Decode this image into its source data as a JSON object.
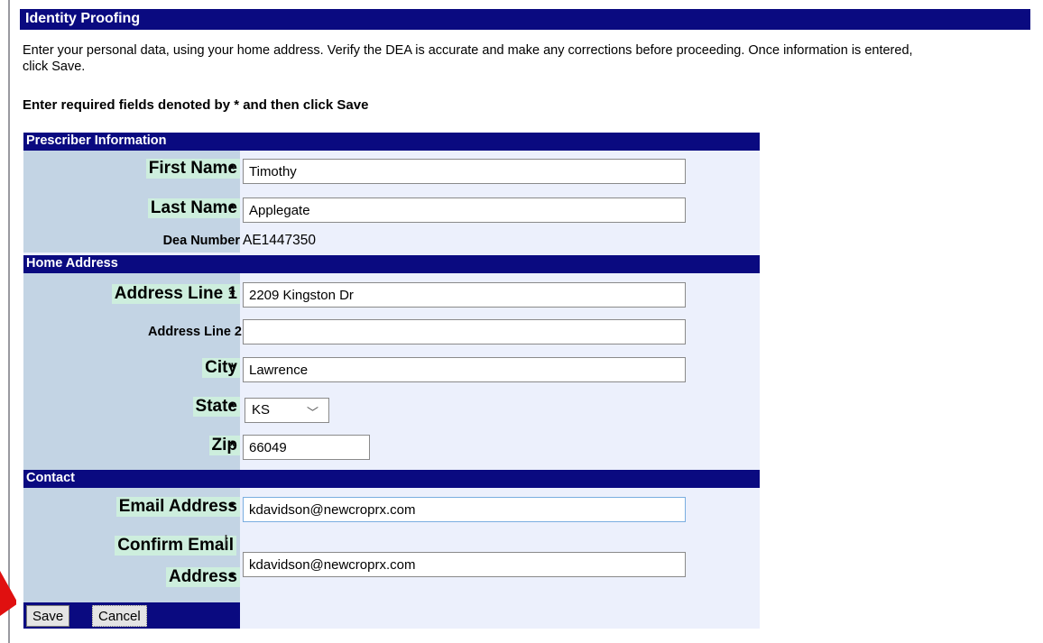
{
  "page": {
    "title": "Identity Proofing",
    "instructions": "Enter your personal data, using your home address. Verify the DEA is accurate and make any corrections before proceeding. Once information is entered, click Save.",
    "required_note": "Enter required fields denoted by * and then click Save"
  },
  "prescriber": {
    "section_title": "Prescriber Information",
    "first_name": {
      "label": "First Name",
      "value": "Timothy"
    },
    "last_name": {
      "label": "Last Name",
      "value": "Applegate"
    },
    "dea": {
      "label": "Dea Number",
      "value": "AE1447350"
    }
  },
  "home_address": {
    "section_title": "Home Address",
    "line1": {
      "label": "Address Line 1",
      "value": "2209 Kingston Dr"
    },
    "line2": {
      "label": "Address Line 2",
      "value": ""
    },
    "city": {
      "label": "City",
      "value": "Lawrence"
    },
    "state": {
      "label": "State",
      "value": "KS"
    },
    "zip": {
      "label": "Zip",
      "value": "66049"
    }
  },
  "contact": {
    "section_title": "Contact",
    "email": {
      "label": "Email Address",
      "value": "kdavidson@newcroprx.com"
    },
    "confirm_email": {
      "label_line1": "Confirm Email",
      "label_line2": "Address",
      "value": "kdavidson@newcroprx.com"
    }
  },
  "required_marker": "*",
  "buttons": {
    "save": "Save",
    "cancel": "Cancel"
  },
  "icons": {
    "state_dropdown": "chevron-down-icon",
    "pointer": "red-arrow-icon"
  },
  "colors": {
    "header_bar": "#0a0a80",
    "label_highlight": "#cdeedd",
    "form_bg": "#ecf0fc",
    "pointer": "#e01010"
  }
}
